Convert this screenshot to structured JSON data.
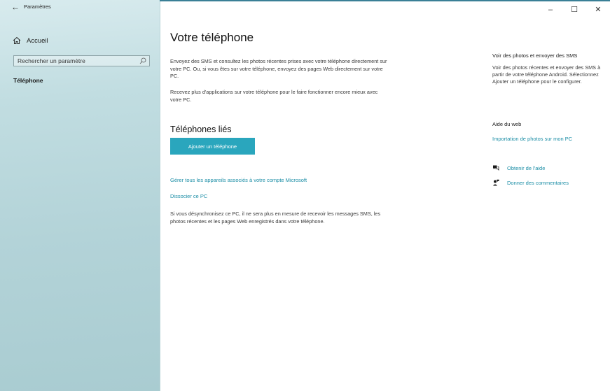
{
  "window": {
    "title": "Paramètres",
    "minimize": "–",
    "maximize": "☐",
    "close": "✕"
  },
  "sidebar": {
    "home_label": "Accueil",
    "search_placeholder": "Rechercher un paramètre",
    "selected_item": "Téléphone"
  },
  "main": {
    "title": "Votre téléphone",
    "para1": "Envoyez des SMS et consultez les photos récentes prises avec votre téléphone directement sur votre PC. Ou, si vous êtes sur votre téléphone, envoyez des pages Web directement sur votre PC.",
    "para2": "Recevez plus d'applications sur votre téléphone pour le faire fonctionner encore mieux avec votre PC.",
    "linked_title": "Téléphones liés",
    "add_phone_label": "Ajouter un téléphone",
    "manage_link": "Gérer tous les appareils associés à votre compte Microsoft",
    "unlink_link": "Dissocier ce PC",
    "para3": "Si vous désynchronisez ce PC, il ne sera plus en mesure de recevoir les messages SMS, les photos récentes et les pages Web enregistrés dans votre téléphone."
  },
  "right": {
    "heading1": "Voir des photos et envoyer des SMS",
    "para": "Voir des photos récentes et envoyer des SMS à partir de votre téléphone Android. Sélectionnez Ajouter un téléphone pour le configurer.",
    "heading2": "Aide du web",
    "import_link": "Importation de photos sur mon PC",
    "help_link": "Obtenir de l'aide",
    "feedback_link": "Donner des commentaires"
  },
  "colors": {
    "accent": "#2aa6bd",
    "link": "#1c8ea6"
  }
}
